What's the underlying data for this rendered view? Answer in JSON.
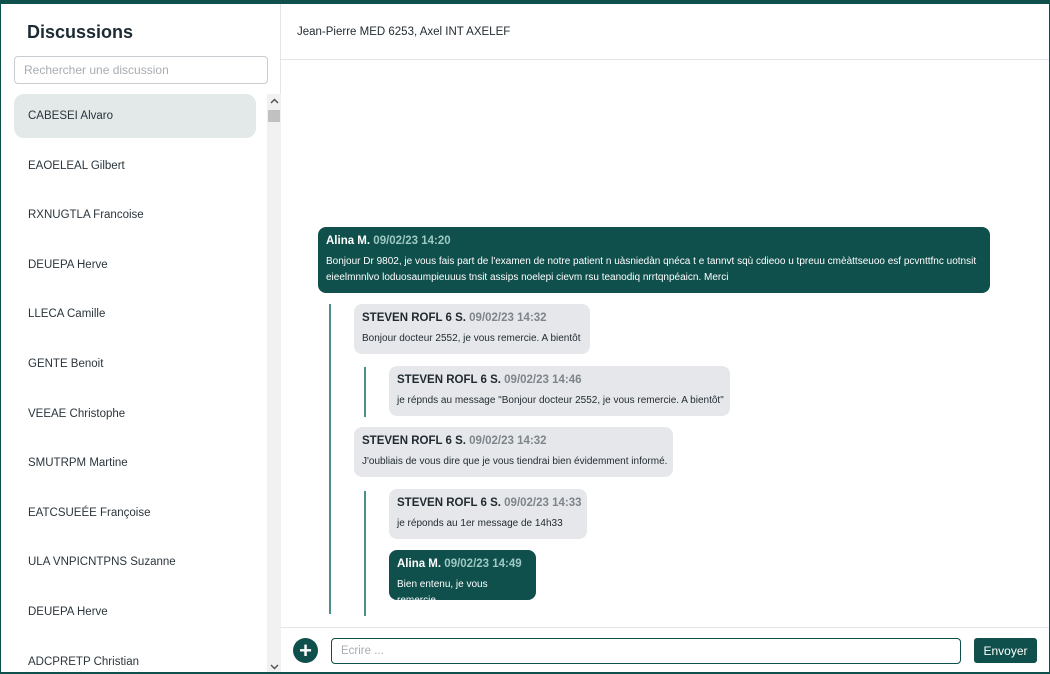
{
  "sidebar": {
    "title": "Discussions",
    "search_placeholder": "Rechercher une discussion",
    "contacts": [
      "CABESEI Alvaro",
      "EAOELEAL Gilbert",
      "RXNUGTLA Francoise",
      "DEUEPA Herve",
      "LLECA Camille",
      "GENTE Benoit",
      "VEEAE Christophe",
      "SMUTRPM Martine",
      "EATCSUEÉE Françoise",
      "ULA VNPICNTPNS Suzanne",
      "DEUEPA Herve",
      "ADCPRETP Christian"
    ],
    "active_index": 0
  },
  "conversation": {
    "title": "Jean-Pierre MED 6253, Axel INT AXELEF",
    "messages": [
      {
        "author": "Alina M.",
        "date": "09/02/23 14:20",
        "text": "Bonjour Dr 9802, je vous fais part de l'examen de notre patient n uàsniedàn qnéca t e tannvt sqù cdieoo u tpreuu cmèàttseuoo esf pcvnttfnc uotnsit eieelmnnlvo loduosaumpieuuus tnsit assips noelepi cievm rsu teanodiq nrrtqnpéaicn. Merci",
        "style": "dark"
      },
      {
        "author": "STEVEN ROFL 6 S.",
        "date": "09/02/23 14:32",
        "text": "Bonjour docteur 2552, je vous remercie. A bientôt",
        "style": "light"
      },
      {
        "author": "STEVEN ROFL 6 S.",
        "date": "09/02/23 14:46",
        "text": "je répnds au message \"Bonjour docteur 2552, je vous remercie. A bientôt\"",
        "style": "light"
      },
      {
        "author": "STEVEN ROFL 6 S.",
        "date": "09/02/23 14:32",
        "text": "J'oubliais de vous dire que je vous tiendrai bien évidemment informé.",
        "style": "light"
      },
      {
        "author": "STEVEN ROFL 6 S.",
        "date": "09/02/23 14:33",
        "text": "je réponds au 1er message de 14h33",
        "style": "light"
      },
      {
        "author": "Alina M.",
        "date": "09/02/23 14:49",
        "text": "Bien entenu, je vous remercie",
        "style": "dark"
      }
    ]
  },
  "composer": {
    "placeholder": "Ecrire ...",
    "add_label": "+",
    "send_label": "Envoyer"
  },
  "colors": {
    "accent": "#0f4f4c",
    "light_bubble": "#e6e7ea",
    "active_contact": "#e3e8e8",
    "thread_line": "#4f8f8a"
  }
}
